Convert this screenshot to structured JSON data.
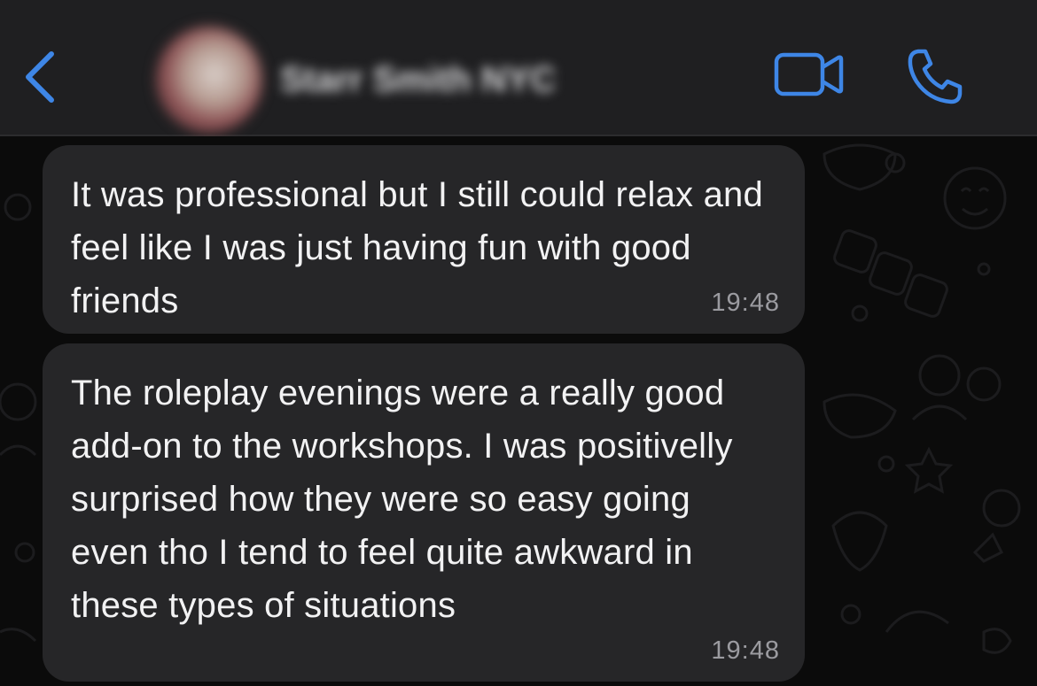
{
  "header": {
    "back_icon": "chevron-left-icon",
    "contact_name": "Starr Smith NYC",
    "video_icon": "video-camera-icon",
    "call_icon": "phone-icon",
    "accent_color": "#3e86e6"
  },
  "messages": [
    {
      "text": "It was professional but I still could relax and feel like I was just having fun with good friends",
      "time": "19:48"
    },
    {
      "text": "The roleplay evenings were a really good add-on to the workshops. I was positivelly surprised how they were so easy going even tho I tend to feel quite awkward in these types of situations",
      "time": "19:48"
    }
  ]
}
